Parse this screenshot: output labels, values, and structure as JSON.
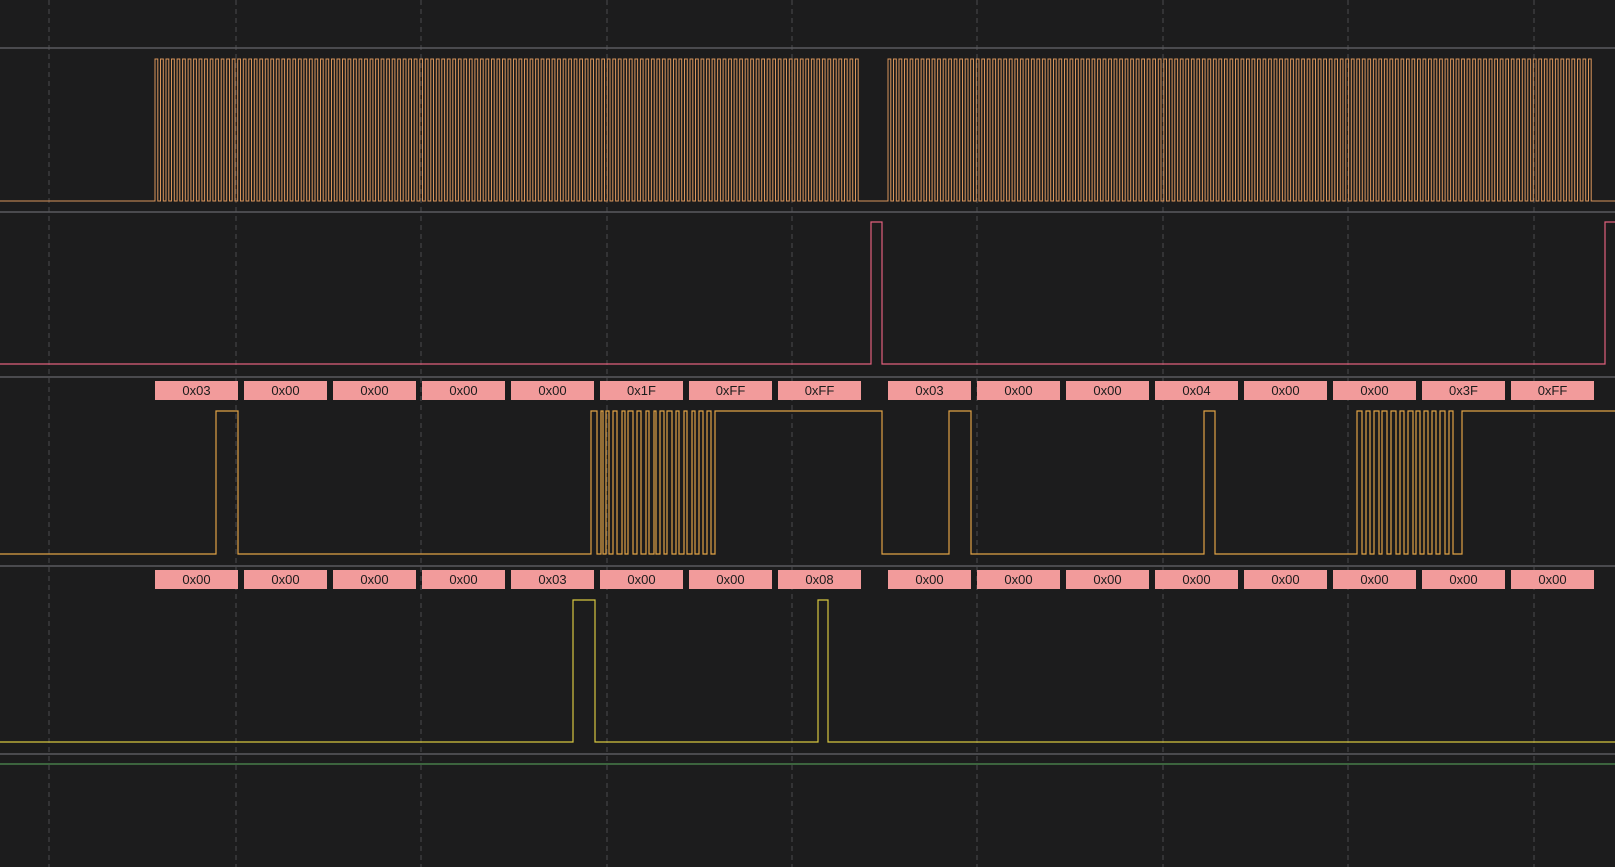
{
  "colors": {
    "background": "#1c1c1d",
    "grid": "#4a4a4d",
    "separator": "#5a5a5e",
    "decode_label_bg": "#f29b9b",
    "decode_label_text": "#1c1c1c",
    "green_line": "#4f8f52"
  },
  "channels": [
    {
      "id": "clock",
      "color": "#d9955a"
    },
    {
      "id": "select",
      "color": "#e0607c"
    },
    {
      "id": "data0",
      "color": "#e0a245"
    },
    {
      "id": "data1",
      "color": "#d6c640"
    }
  ],
  "decode": {
    "data0": [
      "0x03",
      "0x00",
      "0x00",
      "0x00",
      "0x00",
      "0x1F",
      "0xFF",
      "0xFF",
      "0x03",
      "0x00",
      "0x00",
      "0x04",
      "0x00",
      "0x00",
      "0x3F",
      "0xFF"
    ],
    "data1": [
      "0x00",
      "0x00",
      "0x00",
      "0x00",
      "0x03",
      "0x00",
      "0x00",
      "0x08",
      "0x00",
      "0x00",
      "0x00",
      "0x00",
      "0x00",
      "0x00",
      "0x00",
      "0x00"
    ]
  }
}
